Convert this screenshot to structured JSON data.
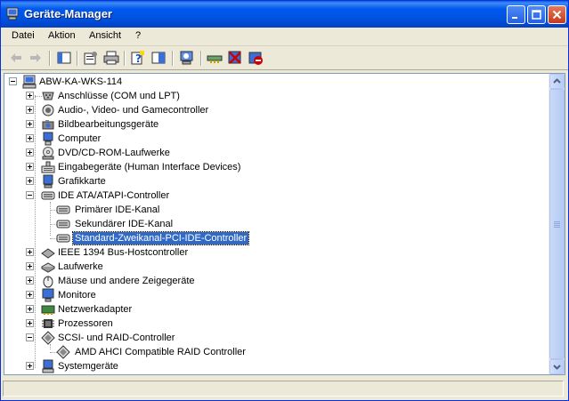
{
  "window": {
    "title": "Geräte-Manager"
  },
  "menu": [
    "Datei",
    "Aktion",
    "Ansicht",
    "?"
  ],
  "toolbar": {
    "buttons": [
      "back-arrow-icon",
      "forward-arrow-icon",
      "tree-view-icon",
      "properties-icon",
      "print-icon",
      "help-icon",
      "console-icon",
      "scan-hardware-icon",
      "update-driver-icon",
      "disable-device-icon",
      "uninstall-device-icon"
    ]
  },
  "tree": {
    "root": "ABW-KA-WKS-114",
    "items": [
      {
        "label": "Anschlüsse (COM und LPT)",
        "icon": "port-icon"
      },
      {
        "label": "Audio-, Video- und Gamecontroller",
        "icon": "speaker-icon"
      },
      {
        "label": "Bildbearbeitungsgeräte",
        "icon": "camera-icon"
      },
      {
        "label": "Computer",
        "icon": "computer-icon"
      },
      {
        "label": "DVD/CD-ROM-Laufwerke",
        "icon": "cd-drive-icon"
      },
      {
        "label": "Eingabegeräte (Human Interface Devices)",
        "icon": "hid-icon"
      },
      {
        "label": "Grafikkarte",
        "icon": "display-adapter-icon"
      },
      {
        "label": "IDE ATA/ATAPI-Controller",
        "icon": "ide-controller-icon",
        "children": [
          "Primärer IDE-Kanal",
          "Sekundärer IDE-Kanal",
          "Standard-Zweikanal-PCI-IDE-Controller"
        ]
      },
      {
        "label": "IEEE 1394 Bus-Hostcontroller",
        "icon": "firewire-icon"
      },
      {
        "label": "Laufwerke",
        "icon": "disk-drive-icon"
      },
      {
        "label": "Mäuse und andere Zeigegeräte",
        "icon": "mouse-icon"
      },
      {
        "label": "Monitore",
        "icon": "monitor-icon"
      },
      {
        "label": "Netzwerkadapter",
        "icon": "network-adapter-icon"
      },
      {
        "label": "Prozessoren",
        "icon": "processor-icon"
      },
      {
        "label": "SCSI- und RAID-Controller",
        "icon": "scsi-icon",
        "children": [
          "AMD AHCI Compatible RAID Controller"
        ]
      },
      {
        "label": "Systemgeräte",
        "icon": "system-devices-icon"
      }
    ],
    "selected": "Standard-Zweikanal-PCI-IDE-Controller"
  },
  "colors": {
    "titlebar": "#0054e3",
    "selection": "#316ac5"
  }
}
